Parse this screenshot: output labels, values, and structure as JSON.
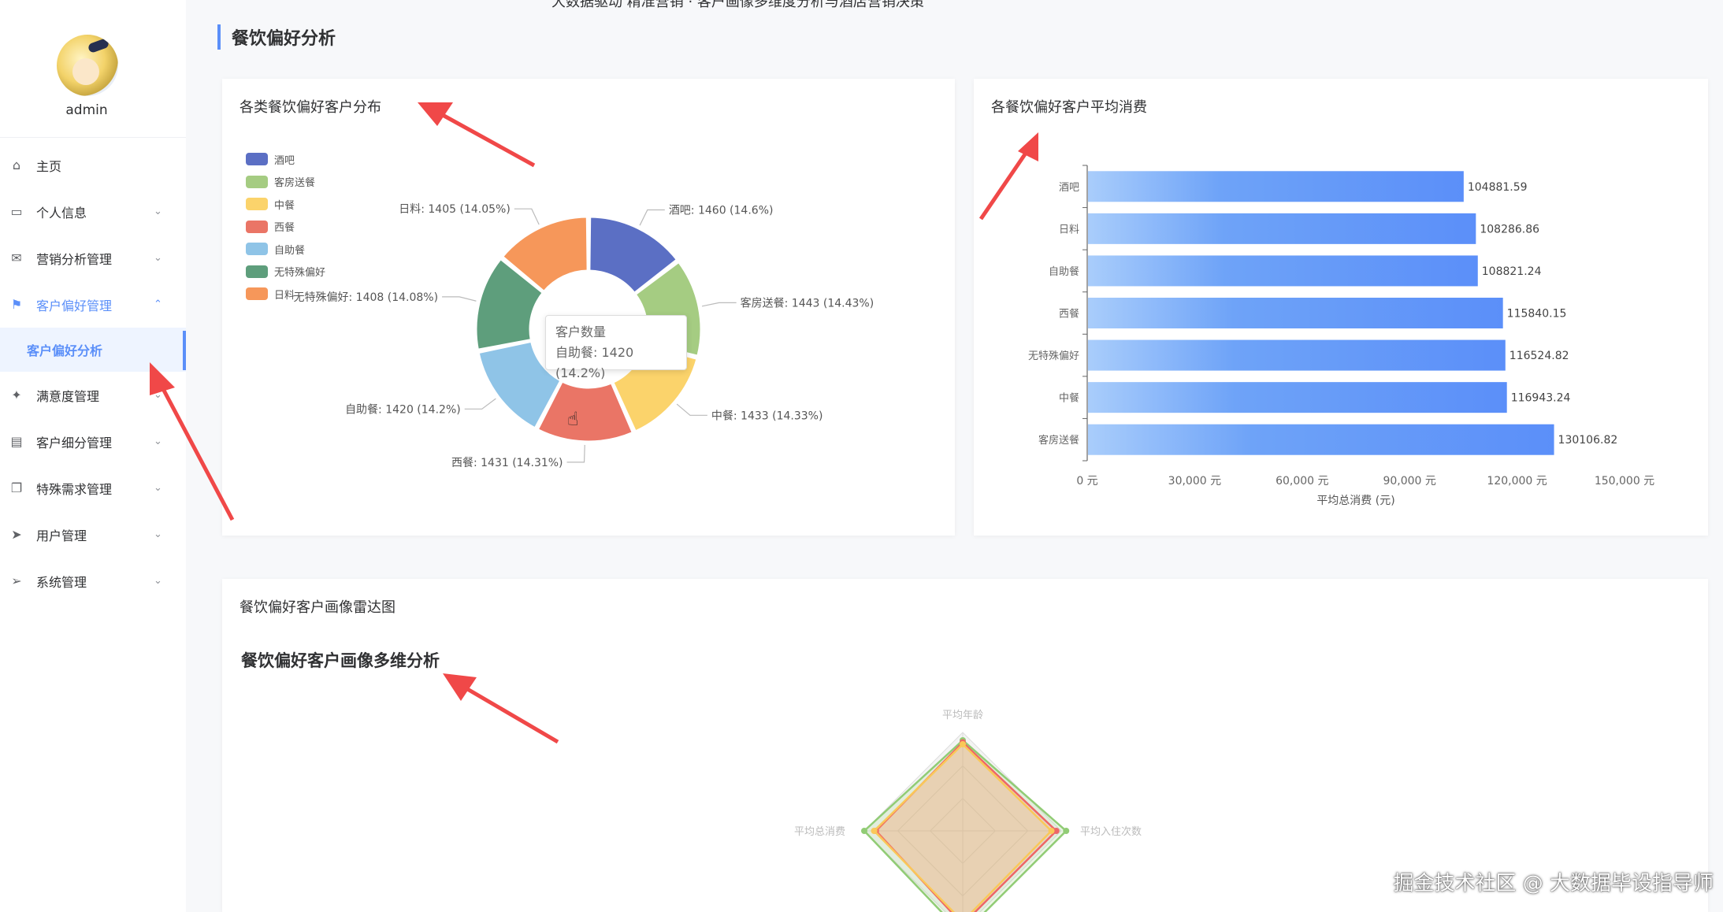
{
  "top_partial_text": "大数据驱动 精准营销 · 客户画像多维度分析与酒店营销决策",
  "sidebar": {
    "username": "admin",
    "items": [
      {
        "label": "主页",
        "icon": "home-icon",
        "has_caret": false
      },
      {
        "label": "个人信息",
        "icon": "id-card-icon",
        "has_caret": true
      },
      {
        "label": "营销分析管理",
        "icon": "mail-icon",
        "has_caret": true
      },
      {
        "label": "客户偏好管理",
        "icon": "flag-icon",
        "has_caret": true,
        "active": true
      },
      {
        "label": "满意度管理",
        "icon": "thumb-icon",
        "has_caret": true
      },
      {
        "label": "客户细分管理",
        "icon": "clipboard-icon",
        "has_caret": true
      },
      {
        "label": "特殊需求管理",
        "icon": "copy-icon",
        "has_caret": true
      },
      {
        "label": "用户管理",
        "icon": "paper-plane-icon",
        "has_caret": true
      },
      {
        "label": "系统管理",
        "icon": "send-icon",
        "has_caret": true
      }
    ],
    "sub_item": "客户偏好分析",
    "caret_down": "⌄",
    "caret_up": "⌃"
  },
  "page_title": "餐饮偏好分析",
  "pie_card": {
    "title": "各类餐饮偏好客户分布",
    "tooltip_title": "客户数量",
    "tooltip_value": "自助餐: 1420 (14.2%)"
  },
  "bar_card": {
    "title": "各餐饮偏好客户平均消费"
  },
  "radar_card": {
    "title": "餐饮偏好客户画像雷达图",
    "chart_title": "餐饮偏好客户画像多维分析",
    "indicators": [
      "平均年龄",
      "平均入住次数",
      "平均总消费"
    ]
  },
  "watermark": "掘金技术社区 @ 大数据毕设指导师",
  "colors": {
    "accent": "#5b8ff9",
    "annotation_arrow": "#f04848"
  },
  "chart_data": [
    {
      "type": "pie",
      "title": "各类餐饮偏好客户分布",
      "donut": true,
      "legend_position": "top-left",
      "slices": [
        {
          "name": "酒吧",
          "value": 1460,
          "percent": 14.6,
          "label": "酒吧: 1460 (14.6%)",
          "color": "#5b6fc4"
        },
        {
          "name": "客房送餐",
          "value": 1443,
          "percent": 14.43,
          "label": "客房送餐: 1443 (14.43%)",
          "color": "#a5cc82"
        },
        {
          "name": "中餐",
          "value": 1433,
          "percent": 14.33,
          "label": "中餐: 1433 (14.33%)",
          "color": "#fbd36b"
        },
        {
          "name": "西餐",
          "value": 1431,
          "percent": 14.31,
          "label": "西餐: 1431 (14.31%)",
          "color": "#ea7566"
        },
        {
          "name": "自助餐",
          "value": 1420,
          "percent": 14.2,
          "label": "自助餐: 1420 (14.2%)",
          "color": "#8fc4e7"
        },
        {
          "name": "无特殊偏好",
          "value": 1408,
          "percent": 14.08,
          "label": "无特殊偏好: 1408 (14.08%)",
          "color": "#5e9e7c"
        },
        {
          "name": "日料",
          "value": 1405,
          "percent": 14.05,
          "label": "日料: 1405 (14.05%)",
          "color": "#f6975a"
        }
      ]
    },
    {
      "type": "bar",
      "orientation": "horizontal",
      "title": "各餐饮偏好客户平均消费",
      "categories": [
        "酒吧",
        "日料",
        "自助餐",
        "西餐",
        "无特殊偏好",
        "中餐",
        "客房送餐"
      ],
      "values": [
        104881.59,
        108286.86,
        108821.24,
        115840.15,
        116524.82,
        116943.24,
        130106.82
      ],
      "value_labels": [
        "104881.59",
        "108286.86",
        "108821.24",
        "115840.15",
        "116524.82",
        "116943.24",
        "130106.82"
      ],
      "xlabel": "平均总消费 (元)",
      "xlim": [
        0,
        150000
      ],
      "xticks": [
        0,
        30000,
        60000,
        90000,
        120000,
        150000
      ],
      "xtick_labels": [
        "0 元",
        "30,000 元",
        "60,000 元",
        "90,000 元",
        "120,000 元",
        "150,000 元"
      ],
      "bar_color": "#5b8ff9"
    },
    {
      "type": "radar",
      "title": "餐饮偏好客户画像多维分析",
      "indicators": [
        "平均年龄",
        "平均入住次数",
        "平均总消费"
      ],
      "series_colors": [
        "#91cc75",
        "#ee6666",
        "#fac858"
      ]
    }
  ]
}
